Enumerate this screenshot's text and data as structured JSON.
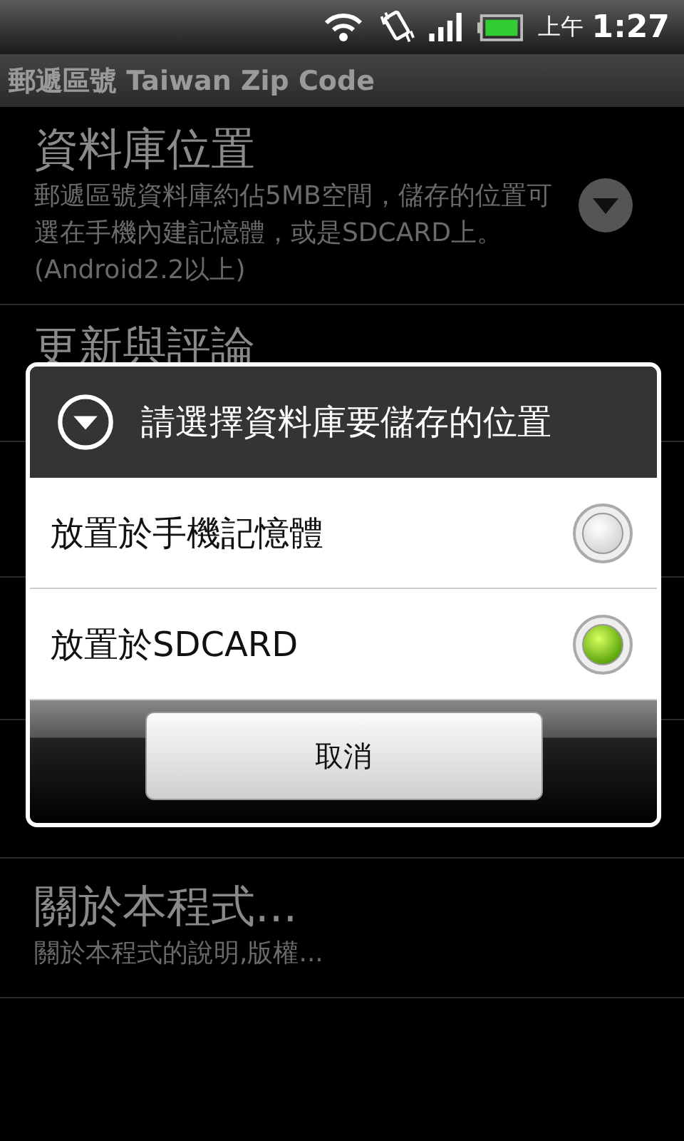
{
  "status_bar": {
    "am_pm": "上午",
    "time": "1:27"
  },
  "title_bar": {
    "title": "郵遞區號 Taiwan Zip Code"
  },
  "preferences": [
    {
      "kind": "list",
      "title": "資料庫位置",
      "summary": "郵遞區號資料庫約佔5MB空間，儲存的位置可選在手機內建記憶體，或是SDCARD上。(Android2.2以上)"
    },
    {
      "kind": "covered",
      "title": "更新與評論"
    },
    {
      "kind": "plain",
      "title": "關於本程式...",
      "summary": "關於本程式的說明,版權..."
    }
  ],
  "dialog": {
    "title": "請選擇資料庫要儲存的位置",
    "options": [
      {
        "label": "放置於手機記憶體",
        "selected": false
      },
      {
        "label": "放置於SDCARD",
        "selected": true
      }
    ],
    "cancel_button": "取消"
  }
}
